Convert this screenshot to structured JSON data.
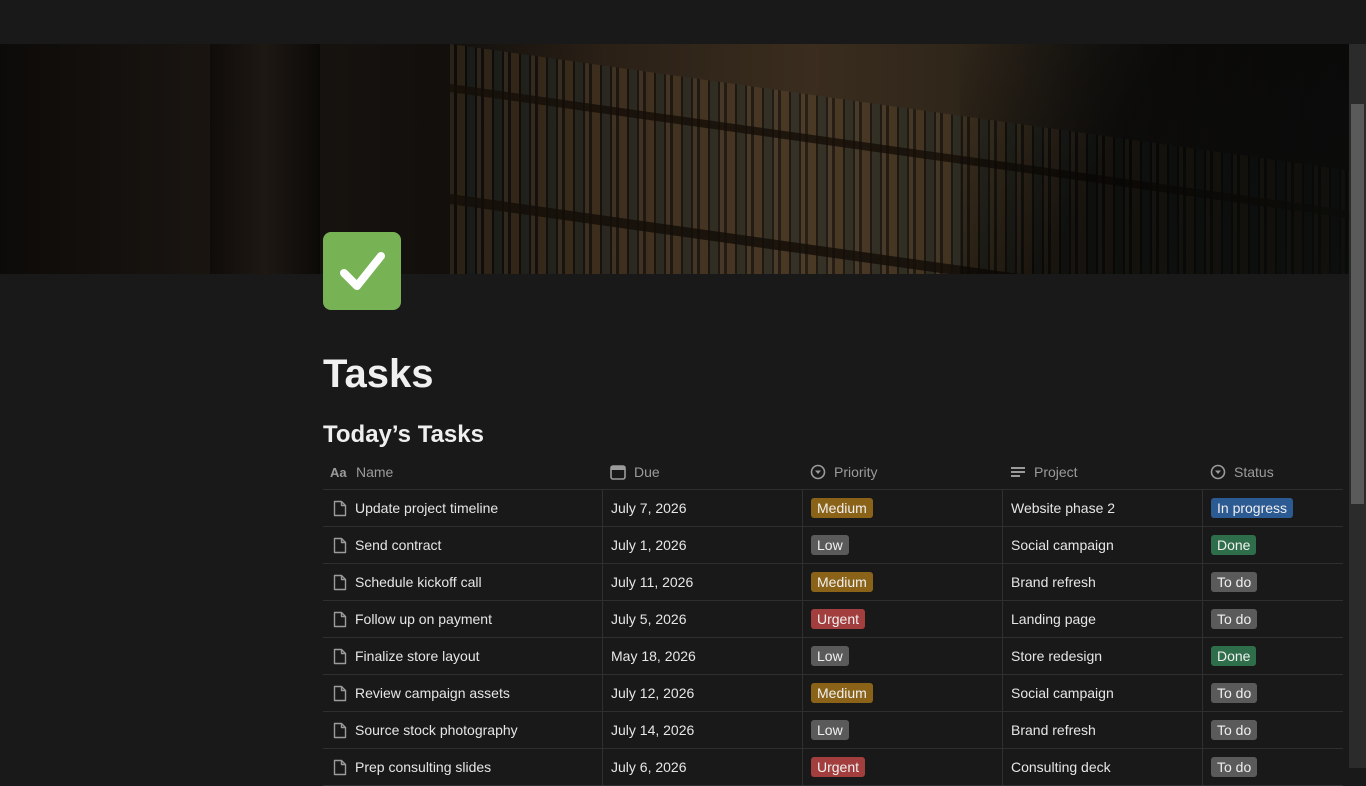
{
  "page": {
    "title": "Tasks",
    "icon": "check-mark-icon"
  },
  "section": {
    "heading": "Today’s Tasks"
  },
  "columns": [
    {
      "label": "Name",
      "icon": "text-icon"
    },
    {
      "label": "Due",
      "icon": "calendar-icon"
    },
    {
      "label": "Priority",
      "icon": "select-icon"
    },
    {
      "label": "Project",
      "icon": "list-icon"
    },
    {
      "label": "Status",
      "icon": "status-icon"
    }
  ],
  "tag_colors": {
    "Medium": "#8a6318",
    "Low": "#5a5a5a",
    "Urgent": "#a33e3e",
    "In progress": "#2c5a92",
    "Done": "#2f6e4b",
    "To do": "#5a5a5a"
  },
  "rows": [
    {
      "name": "Update project timeline",
      "due": "July 7, 2026",
      "priority": "Medium",
      "project": "Website phase 2",
      "status": "In progress"
    },
    {
      "name": "Send contract",
      "due": "July 1, 2026",
      "priority": "Low",
      "project": "Social campaign",
      "status": "Done"
    },
    {
      "name": "Schedule kickoff call",
      "due": "July 11, 2026",
      "priority": "Medium",
      "project": "Brand refresh",
      "status": "To do"
    },
    {
      "name": "Follow up on payment",
      "due": "July 5, 2026",
      "priority": "Urgent",
      "project": "Landing page",
      "status": "To do"
    },
    {
      "name": "Finalize store layout",
      "due": "May 18, 2026",
      "priority": "Low",
      "project": "Store redesign",
      "status": "Done"
    },
    {
      "name": "Review campaign assets",
      "due": "July 12, 2026",
      "priority": "Medium",
      "project": "Social campaign",
      "status": "To do"
    },
    {
      "name": "Source stock photography",
      "due": "July 14, 2026",
      "priority": "Low",
      "project": "Brand refresh",
      "status": "To do"
    },
    {
      "name": "Prep consulting slides",
      "due": "July 6, 2026",
      "priority": "Urgent",
      "project": "Consulting deck",
      "status": "To do"
    }
  ]
}
